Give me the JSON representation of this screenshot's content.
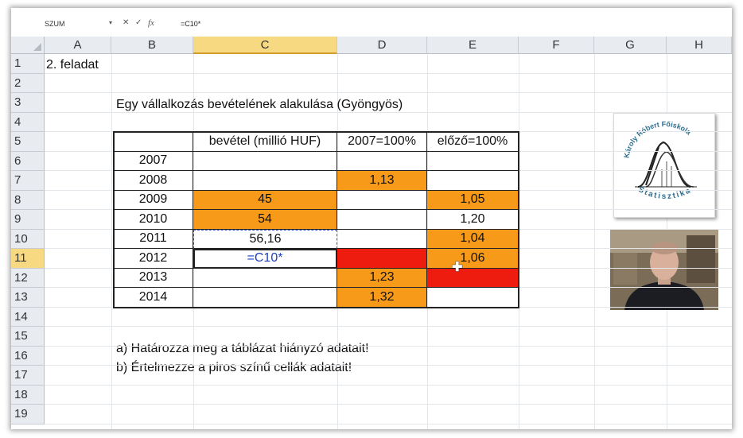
{
  "formula_bar": {
    "name_box": "SZUM",
    "cancel_icon": "✕",
    "enter_icon": "✓",
    "fx_label": "fx",
    "formula": "=C10*"
  },
  "columns": [
    "A",
    "B",
    "C",
    "D",
    "E",
    "F",
    "G",
    "H"
  ],
  "rows": [
    "1",
    "2",
    "3",
    "4",
    "5",
    "6",
    "7",
    "8",
    "9",
    "10",
    "11",
    "12",
    "13",
    "14",
    "15",
    "16",
    "17",
    "18",
    "19"
  ],
  "sheet": {
    "a1": "2. feladat",
    "b3": "Egy vállalkozás bevételének alakulása (Gyöngyös)",
    "b15": "a) Határozza meg a táblázat hiányzó adatait!",
    "b16": "b) Értelmezze a piros színű cellák adatait!"
  },
  "table": {
    "headers": [
      "",
      "bevétel (millió HUF)",
      "2007=100%",
      "előző=100%"
    ],
    "rows": [
      {
        "year": "2007",
        "c": "",
        "d": "",
        "e": ""
      },
      {
        "year": "2008",
        "c": "",
        "d": "1,13",
        "e": ""
      },
      {
        "year": "2009",
        "c": "45",
        "d": "",
        "e": "1,05"
      },
      {
        "year": "2010",
        "c": "54",
        "d": "",
        "e": "1,20"
      },
      {
        "year": "2011",
        "c": "56,16",
        "d": "",
        "e": "1,04"
      },
      {
        "year": "2012",
        "c": "=C10*",
        "d": "",
        "e": "1,06"
      },
      {
        "year": "2013",
        "c": "",
        "d": "1,23",
        "e": ""
      },
      {
        "year": "2014",
        "c": "",
        "d": "1,32",
        "e": ""
      }
    ],
    "colors": {
      "orange": "#f79a1a",
      "red": "#ee1c0f"
    }
  },
  "logo": {
    "text_top": "Károly Róbert Főiskola",
    "text_bottom": "Statisztika"
  },
  "selected_cell": "C11"
}
